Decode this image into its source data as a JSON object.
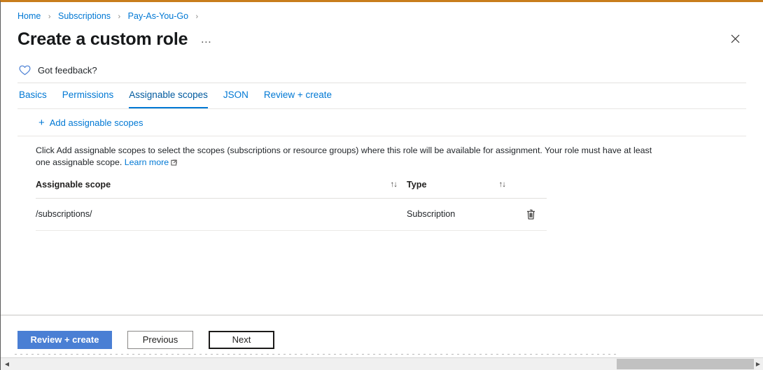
{
  "window": {
    "accent_top_color": "#c87d1c"
  },
  "breadcrumb": {
    "items": [
      {
        "label": "Home"
      },
      {
        "label": "Subscriptions"
      },
      {
        "label": "Pay-As-You-Go"
      }
    ],
    "separator": "›"
  },
  "header": {
    "title": "Create a custom role",
    "ellipsis": "…",
    "close_label": "Close"
  },
  "feedback": {
    "icon": "heart-icon",
    "label": "Got feedback?"
  },
  "tabs": [
    {
      "label": "Basics",
      "active": false
    },
    {
      "label": "Permissions",
      "active": false
    },
    {
      "label": "Assignable scopes",
      "active": true
    },
    {
      "label": "JSON",
      "active": false
    },
    {
      "label": "Review + create",
      "active": false
    }
  ],
  "commandbar": {
    "add_plus": "+",
    "add_label": "Add assignable scopes"
  },
  "description": {
    "text": "Click Add assignable scopes to select the scopes (subscriptions or resource groups) where this role will be available for assignment. Your role must have at least one assignable scope.",
    "link_label": "Learn more"
  },
  "table": {
    "columns": [
      {
        "key": "scope",
        "label": "Assignable scope",
        "sort_glyph": "↑↓"
      },
      {
        "key": "type",
        "label": "Type",
        "sort_glyph": "↑↓"
      }
    ],
    "rows": [
      {
        "scope": "/subscriptions/",
        "type": "Subscription",
        "delete_label": "Delete"
      }
    ]
  },
  "footer": {
    "review_create": "Review + create",
    "previous": "Previous",
    "next": "Next",
    "primary_color": "#4a7fd4"
  },
  "scrollbar": {
    "left_arrow": "◀",
    "right_arrow": "▶"
  }
}
